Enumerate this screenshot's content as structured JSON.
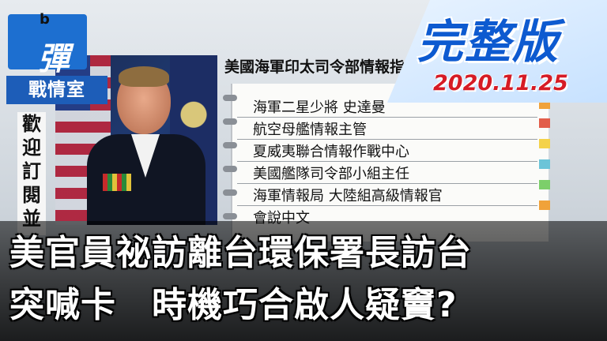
{
  "logo": {
    "mark": "彈",
    "letter": "b",
    "name": "戰情室"
  },
  "sidebar": {
    "text": "歡迎訂閱並"
  },
  "badge": {
    "label": "完整版",
    "date": "2020.11.25"
  },
  "panel": {
    "title": "美國海軍印太司令部情報指",
    "items": [
      "海軍二星少將 史達曼",
      "航空母艦情報主管",
      "夏威夷聯合情報作戰中心",
      "美國艦隊司令部小組主任",
      "海軍情報局 大陸組高級情報官",
      "會說中文"
    ]
  },
  "caption": {
    "line1": "美官員祕訪離台環保署長訪台",
    "line2": "突喊卡　時機巧合啟人疑竇?"
  },
  "colors": {
    "brand_blue": "#1d5db8",
    "date_red": "#d61b25",
    "badge_blue": "#0d5ad0"
  }
}
